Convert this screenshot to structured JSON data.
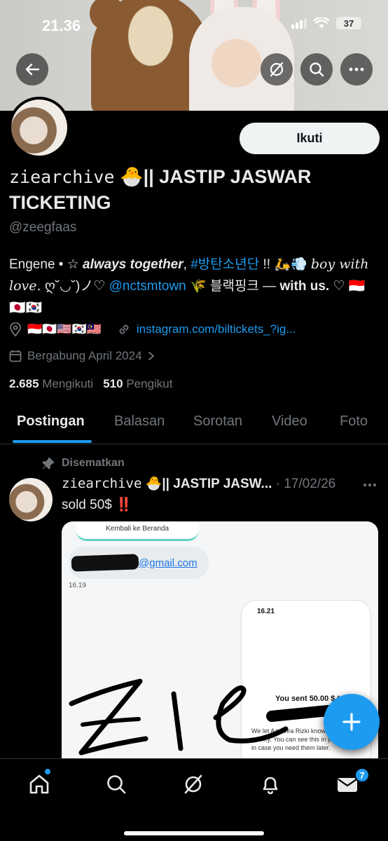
{
  "status_bar": {
    "time": "21.36",
    "battery": "37"
  },
  "profile": {
    "follow_label": "Ikuti",
    "name_mono": "ziearchive",
    "name_emoji": "🐣",
    "name_rest": "|| JASTIP JASWAR TICKETING",
    "handle": "@zeegfaas",
    "bio": {
      "p1": "Engene • ☆ ",
      "p2": "always together",
      "p3": ", ",
      "hashtag": "#방탄소년단",
      "p4": " !! 🛵💨 ",
      "p5": "boy with love.",
      "p6": " ღ˘◡˘)ノ♡ ",
      "mention": "@nctsmtown",
      "p7": " 🌾 블랙핑크 — ",
      "p8": "with us.",
      "p9": " ♡ 🇮🇩🇯🇵🇰🇷"
    },
    "location": "🇮🇩🇯🇵🇺🇸🇰🇷🇲🇾",
    "website": "instagram.com/biltickets_?ig...",
    "joined": "Bergabung April 2024",
    "following_count": "2.685",
    "following_label": "Mengikuti",
    "followers_count": "510",
    "followers_label": "Pengikut"
  },
  "tabs": [
    "Postingan",
    "Balasan",
    "Sorotan",
    "Video",
    "Foto"
  ],
  "post": {
    "pinned_label": "Disematkan",
    "author_mono": "ziearchive",
    "author_emoji": "🐣",
    "author_rest": "|| JASTIP JASW...",
    "date": "· 17/02/26",
    "text": "sold 50$",
    "text_emoji": "‼️",
    "media": {
      "back_label": "Kembali ke Beranda",
      "email": "@gmail.com",
      "time_left": "16.19",
      "phone_time": "16.21",
      "sent_text": "You sent 50.00 $ to",
      "desc_text": "We let Azzahra Rizki know you sent money. You can see this in your Activity in case you need them later."
    }
  },
  "nav": {
    "messages_badge": "7"
  }
}
